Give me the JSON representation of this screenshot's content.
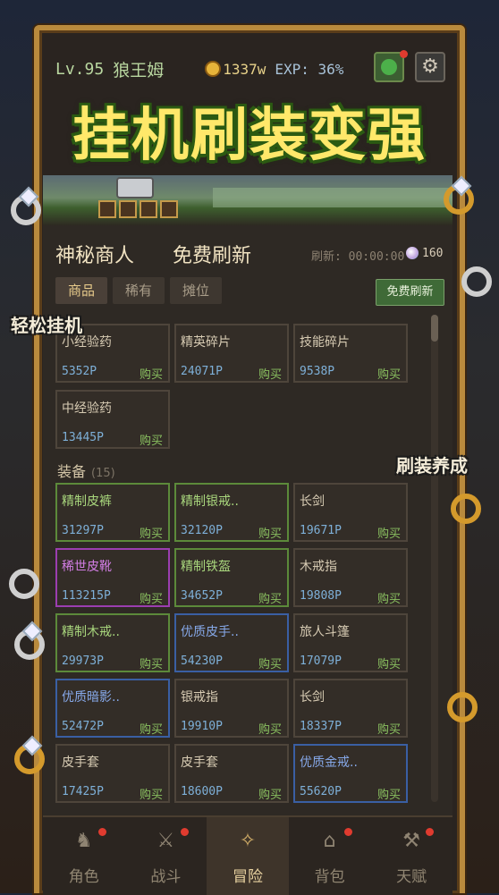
{
  "header": {
    "level": "Lv.95",
    "name": "狼王姆",
    "coins": "1337w",
    "exp": "EXP: 36%"
  },
  "banner": {
    "title": "挂机刷装变强"
  },
  "side_labels": {
    "left": "轻松挂机",
    "right": "刷装养成"
  },
  "shop": {
    "title": "神秘商人",
    "free_refresh_title": "免费刷新",
    "refresh_label": "刷新: 00:00:00",
    "gems": "160",
    "tabs": [
      {
        "label": "商品"
      },
      {
        "label": "稀有"
      },
      {
        "label": "摊位"
      }
    ],
    "free_refresh_button": "免费刷新",
    "buy_label": "购买",
    "consumables": [
      {
        "name": "小经验药",
        "price": "5352P"
      },
      {
        "name": "精英碎片",
        "price": "24071P"
      },
      {
        "name": "技能碎片",
        "price": "9538P"
      },
      {
        "name": "中经验药",
        "price": "13445P"
      }
    ],
    "equip_section": {
      "label": "装备",
      "count": "(15)"
    },
    "equipment": [
      {
        "name": "精制皮裤",
        "price": "31297P",
        "rarity": "green"
      },
      {
        "name": "精制银戒..",
        "price": "32120P",
        "rarity": "green"
      },
      {
        "name": "长剑",
        "price": "19671P",
        "rarity": "common"
      },
      {
        "name": "稀世皮靴",
        "price": "113215P",
        "rarity": "purple"
      },
      {
        "name": "精制铁盔",
        "price": "34652P",
        "rarity": "green"
      },
      {
        "name": "木戒指",
        "price": "19808P",
        "rarity": "common"
      },
      {
        "name": "精制木戒..",
        "price": "29973P",
        "rarity": "green"
      },
      {
        "name": "优质皮手..",
        "price": "54230P",
        "rarity": "blue"
      },
      {
        "name": "旅人斗篷",
        "price": "17079P",
        "rarity": "common"
      },
      {
        "name": "优质暗影..",
        "price": "52472P",
        "rarity": "blue"
      },
      {
        "name": "银戒指",
        "price": "19910P",
        "rarity": "common"
      },
      {
        "name": "长剑",
        "price": "18337P",
        "rarity": "common"
      },
      {
        "name": "皮手套",
        "price": "17425P",
        "rarity": "common"
      },
      {
        "name": "皮手套",
        "price": "18600P",
        "rarity": "common"
      },
      {
        "name": "优质金戒..",
        "price": "55620P",
        "rarity": "blue"
      }
    ]
  },
  "nav": [
    {
      "label": "角色",
      "icon": "knight-icon"
    },
    {
      "label": "战斗",
      "icon": "sword-icon"
    },
    {
      "label": "冒险",
      "icon": "compass-icon"
    },
    {
      "label": "背包",
      "icon": "backpack-icon"
    },
    {
      "label": "天赋",
      "icon": "anvil-icon"
    }
  ],
  "colors": {
    "accent_gold": "#b98a3d",
    "banner_yellow": "#ffe86a",
    "buy_green": "#8ac060",
    "price_blue": "#7eb0d8"
  }
}
